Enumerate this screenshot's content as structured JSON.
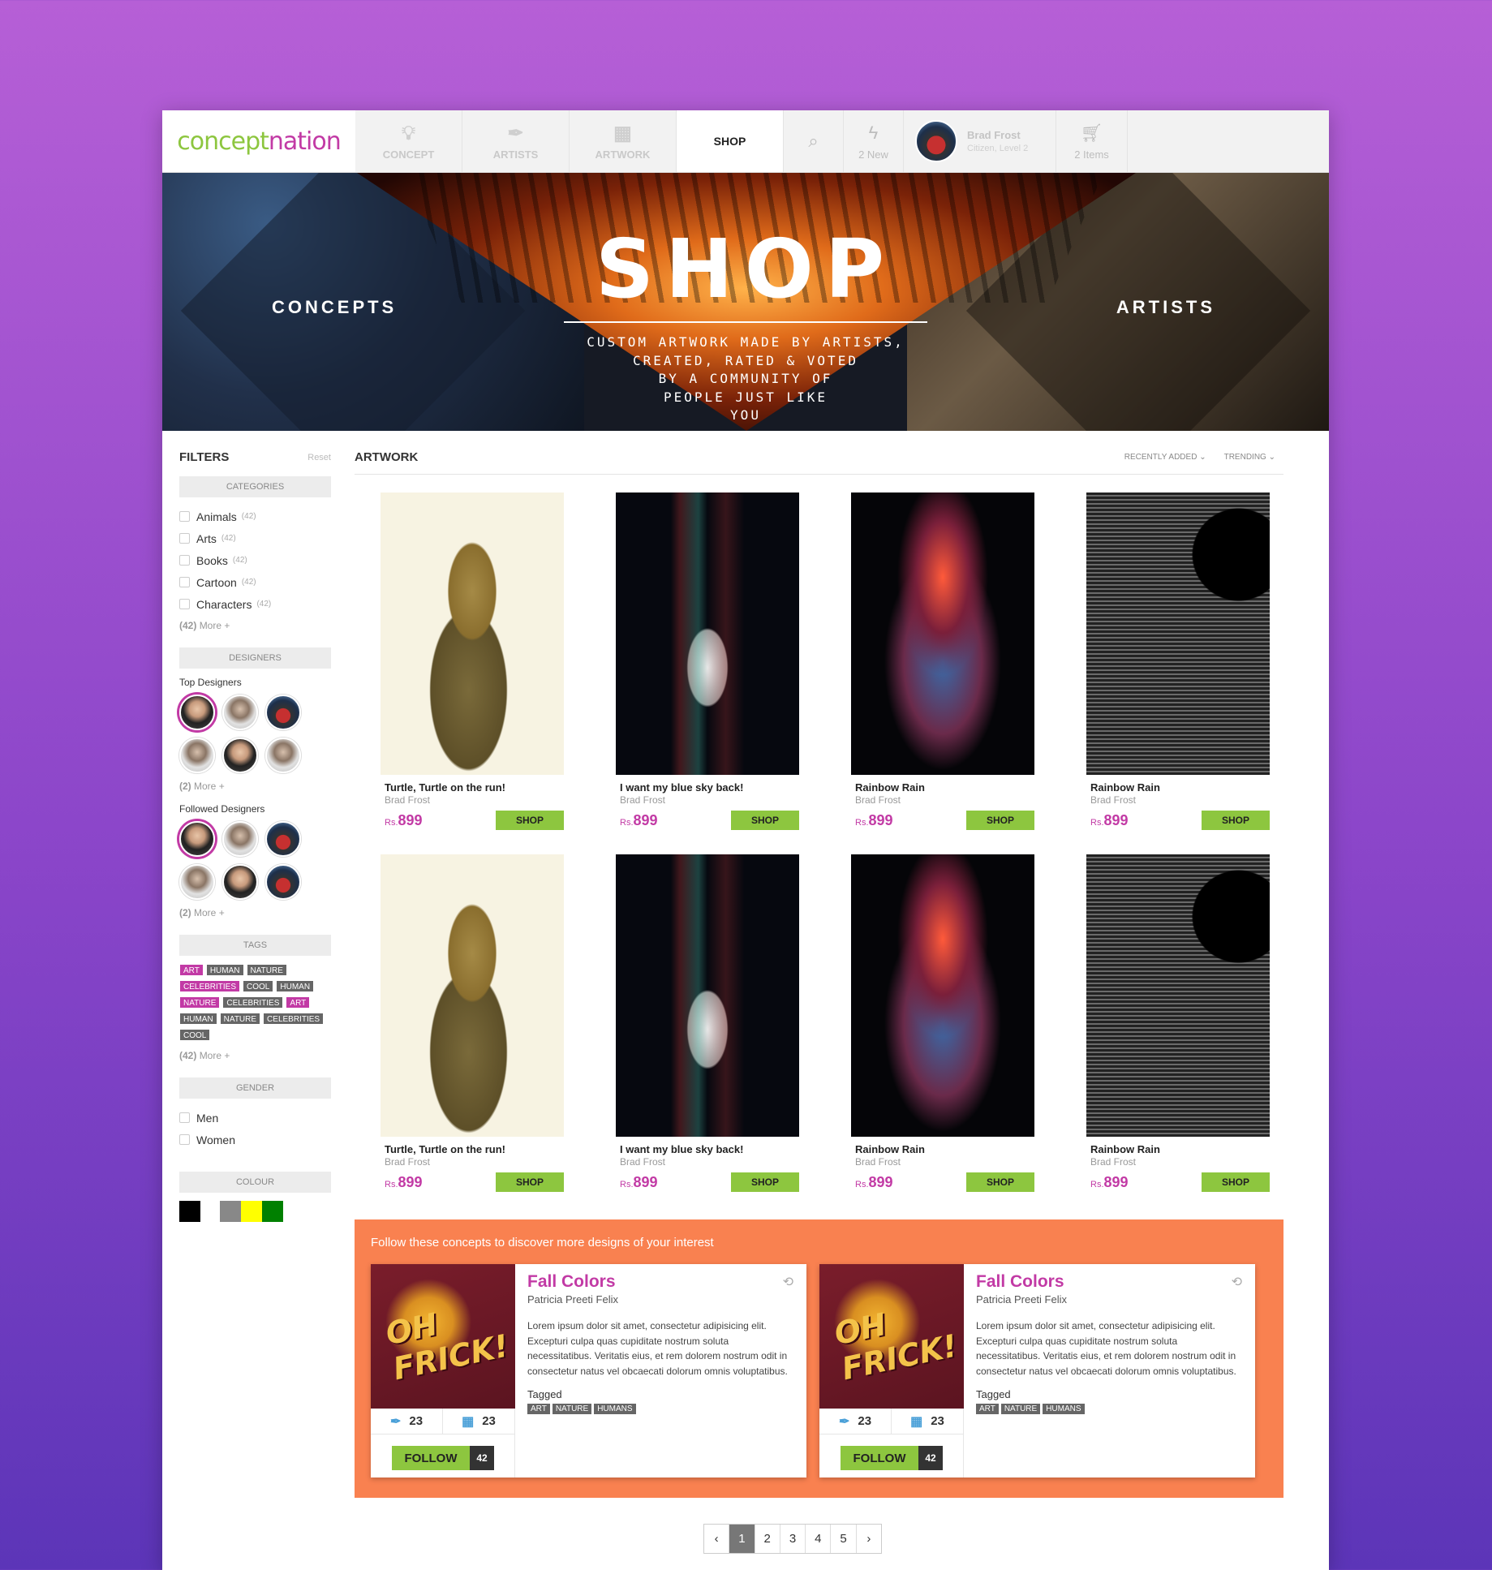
{
  "nav": {
    "logo_a": "concept",
    "logo_b": " nation",
    "items": [
      {
        "label": "CONCEPT",
        "icon": "bulb-icon"
      },
      {
        "label": "ARTISTS",
        "icon": "pen-nib-icon"
      },
      {
        "label": "ARTWORK",
        "icon": "easel-icon"
      }
    ],
    "active": "SHOP",
    "notifications": "2 New",
    "user_name": "Brad Frost",
    "user_level": "Citizen, Level 2",
    "cart": "2 Items"
  },
  "hero": {
    "left": "CONCEPTS",
    "title": "SHOP",
    "right": "ARTISTS",
    "tagline": "CUSTOM ARTWORK MADE BY ARTISTS,\nCREATED, RATED & VOTED\nBY A COMMUNITY OF\nPEOPLE JUST LIKE\nYOU"
  },
  "filters": {
    "title": "FILTERS",
    "reset": "Reset",
    "categories_label": "CATEGORIES",
    "categories": [
      {
        "name": "Animals",
        "count": "(42)"
      },
      {
        "name": "Arts",
        "count": "(42)"
      },
      {
        "name": "Books",
        "count": "(42)"
      },
      {
        "name": "Cartoon",
        "count": "(42)"
      },
      {
        "name": "Characters",
        "count": "(42)"
      }
    ],
    "categories_more_count": "(42)",
    "more": "More +",
    "designers_label": "DESIGNERS",
    "top_designers": "Top Designers",
    "designers_more_count": "(2)",
    "followed_designers": "Followed Designers",
    "followed_more_count": "(2)",
    "tags_label": "TAGS",
    "tags": [
      "ART",
      "HUMAN",
      "NATURE",
      "CELEBRITIES",
      "COOL",
      "HUMAN",
      "NATURE",
      "CELEBRITIES",
      "ART",
      "HUMAN",
      "NATURE",
      "CELEBRITIES",
      "COOL"
    ],
    "tags_more_count": "(42)",
    "gender_label": "GENDER",
    "genders": [
      "Men",
      "Women"
    ],
    "colour_label": "COLOUR",
    "colours": [
      "#000000",
      "#888888",
      "#ffff00",
      "#008000"
    ]
  },
  "artwork": {
    "title": "ARTWORK",
    "sort1": "RECENTLY ADDED",
    "sort2": "TRENDING",
    "currency": "Rs.",
    "shop_label": "SHOP",
    "items": [
      {
        "name": "Turtle, Turtle on the run!",
        "artist": "Brad Frost",
        "price": "899"
      },
      {
        "name": "I want my blue sky back!",
        "artist": "Brad Frost",
        "price": "899"
      },
      {
        "name": "Rainbow Rain",
        "artist": "Brad Frost",
        "price": "899"
      },
      {
        "name": "Rainbow Rain",
        "artist": "Brad Frost",
        "price": "899"
      },
      {
        "name": "Turtle, Turtle on the run!",
        "artist": "Brad Frost",
        "price": "899"
      },
      {
        "name": "I want my blue sky back!",
        "artist": "Brad Frost",
        "price": "899"
      },
      {
        "name": "Rainbow Rain",
        "artist": "Brad Frost",
        "price": "899"
      },
      {
        "name": "Rainbow Rain",
        "artist": "Brad Frost",
        "price": "899"
      }
    ]
  },
  "promo": {
    "title": "Follow these concepts to discover more designs of your interest",
    "cards": [
      {
        "art_text": "OH FRICK!",
        "title": "Fall Colors",
        "author": "Patricia Preeti Felix",
        "desc": "Lorem ipsum dolor sit amet, consectetur adipisicing elit. Excepturi culpa quas cupiditate nostrum soluta necessitatibus. Veritatis eius, et rem dolorem nostrum odit in consectetur natus vel obcaecati dolorum omnis voluptatibus.",
        "tagged": "Tagged",
        "tags": [
          "ART",
          "NATURE",
          "HUMANS"
        ],
        "stat1": "23",
        "stat2": "23",
        "follow": "FOLLOW",
        "follow_count": "42"
      },
      {
        "art_text": "OH FRICK!",
        "title": "Fall Colors",
        "author": "Patricia Preeti Felix",
        "desc": "Lorem ipsum dolor sit amet, consectetur adipisicing elit. Excepturi culpa quas cupiditate nostrum soluta necessitatibus. Veritatis eius, et rem dolorem nostrum odit in consectetur natus vel obcaecati dolorum omnis voluptatibus.",
        "tagged": "Tagged",
        "tags": [
          "ART",
          "NATURE",
          "HUMANS"
        ],
        "stat1": "23",
        "stat2": "23",
        "follow": "FOLLOW",
        "follow_count": "42"
      }
    ]
  },
  "pagination": {
    "prev": "‹",
    "pages": [
      "1",
      "2",
      "3",
      "4",
      "5"
    ],
    "current": "1",
    "next": "›"
  }
}
